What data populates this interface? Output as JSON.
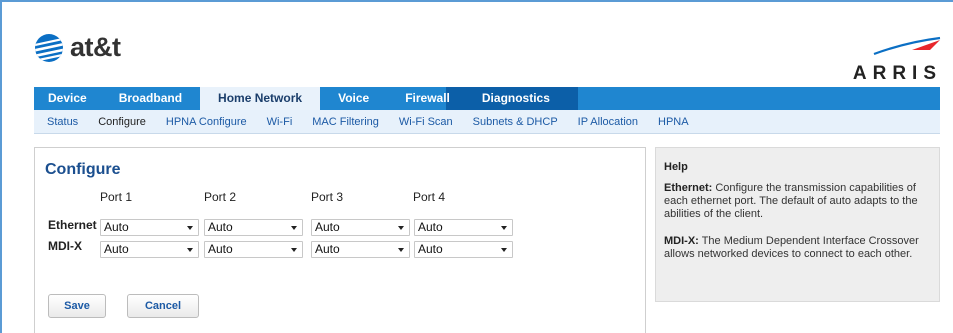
{
  "brand": {
    "att_text": "at&t",
    "arris_text": "ARRIS"
  },
  "nav": {
    "items": [
      {
        "label": "Device"
      },
      {
        "label": "Broadband"
      },
      {
        "label": "Home Network",
        "active": true
      },
      {
        "label": "Voice"
      },
      {
        "label": "Firewall"
      },
      {
        "label": "Diagnostics"
      }
    ]
  },
  "subnav": {
    "items": [
      {
        "label": "Status"
      },
      {
        "label": "Configure",
        "active": true
      },
      {
        "label": "HPNA Configure"
      },
      {
        "label": "Wi-Fi"
      },
      {
        "label": "MAC Filtering"
      },
      {
        "label": "Wi-Fi Scan"
      },
      {
        "label": "Subnets & DHCP"
      },
      {
        "label": "IP Allocation"
      },
      {
        "label": "HPNA"
      }
    ]
  },
  "configure": {
    "title": "Configure",
    "ports": [
      "Port 1",
      "Port 2",
      "Port 3",
      "Port 4"
    ],
    "rows": [
      {
        "label": "Ethernet",
        "values": [
          "Auto",
          "Auto",
          "Auto",
          "Auto"
        ]
      },
      {
        "label": "MDI-X",
        "values": [
          "Auto",
          "Auto",
          "Auto",
          "Auto"
        ]
      }
    ],
    "save_label": "Save",
    "cancel_label": "Cancel"
  },
  "help": {
    "title": "Help",
    "ethernet_term": "Ethernet:",
    "ethernet_text": "Configure the transmission capabilities of each ethernet port. The default of auto adapts to the abilities of the client.",
    "mdix_term": "MDI-X:",
    "mdix_text": "The Medium Dependent Interface Crossover allows networked devices to connect to each other."
  },
  "colors": {
    "nav_blue": "#1f86d0",
    "subnav_bg": "#e7f1fb",
    "title_blue": "#1b4f8f",
    "link_blue": "#1c5aa5"
  }
}
